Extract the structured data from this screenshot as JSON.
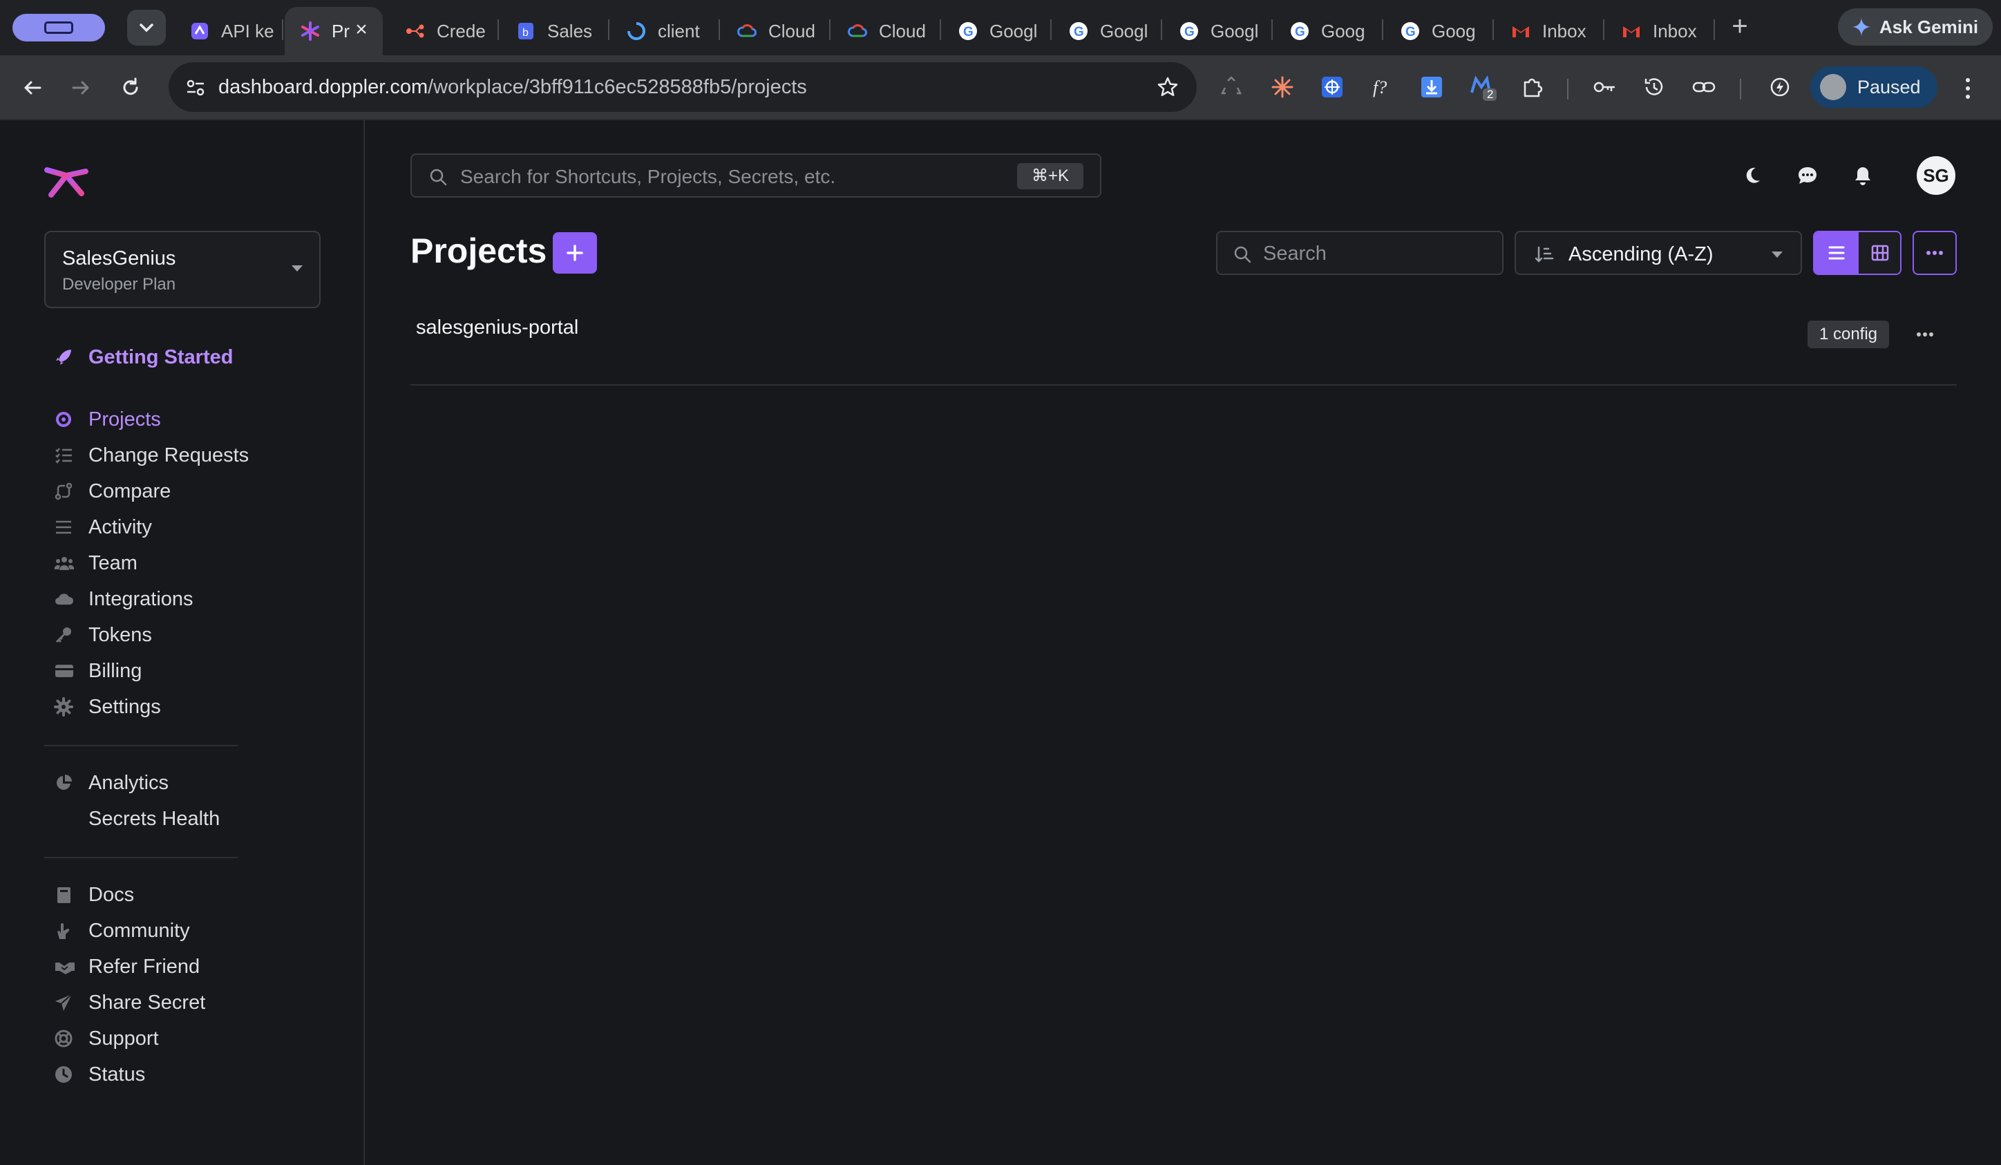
{
  "browser": {
    "tabs": [
      {
        "label": "API ke",
        "favicon": "app-favicon",
        "active": false
      },
      {
        "label": "Pr",
        "favicon": "doppler-favicon",
        "active": true
      },
      {
        "label": "Crede",
        "favicon": "nodes-favicon",
        "active": false
      },
      {
        "label": "Sales",
        "favicon": "salesgenius-favicon",
        "active": false
      },
      {
        "label": "client",
        "favicon": "ring-favicon",
        "active": false
      },
      {
        "label": "Cloud",
        "favicon": "google-cloud-favicon",
        "active": false
      },
      {
        "label": "Cloud",
        "favicon": "google-cloud-favicon",
        "active": false
      },
      {
        "label": "Googl",
        "favicon": "google-favicon",
        "active": false
      },
      {
        "label": "Googl",
        "favicon": "google-favicon",
        "active": false
      },
      {
        "label": "Googl",
        "favicon": "google-favicon",
        "active": false
      },
      {
        "label": "Goog",
        "favicon": "google-favicon",
        "active": false
      },
      {
        "label": "Goog",
        "favicon": "google-favicon",
        "active": false
      },
      {
        "label": "Inbox",
        "favicon": "gmail-favicon",
        "active": false
      },
      {
        "label": "Inbox",
        "favicon": "gmail-favicon",
        "active": false
      }
    ],
    "new_tab": "+",
    "gemini_label": "Ask Gemini",
    "url_host": "dashboard.doppler.com",
    "url_path": "/workplace/3bff911c6ec528588fb5/projects",
    "profile_label": "Paused",
    "extension_badge": "2"
  },
  "sidebar": {
    "workspace_name": "SalesGenius",
    "workspace_plan": "Developer Plan",
    "getting_started": "Getting Started",
    "items": [
      {
        "label": "Projects",
        "icon": "cube-icon"
      },
      {
        "label": "Change Requests",
        "icon": "checklist-icon"
      },
      {
        "label": "Compare",
        "icon": "compare-icon"
      },
      {
        "label": "Activity",
        "icon": "activity-icon"
      },
      {
        "label": "Team",
        "icon": "team-icon"
      },
      {
        "label": "Integrations",
        "icon": "cloud-icon"
      },
      {
        "label": "Tokens",
        "icon": "key-icon"
      },
      {
        "label": "Billing",
        "icon": "credit-card-icon"
      },
      {
        "label": "Settings",
        "icon": "gear-icon"
      }
    ],
    "analytics": [
      {
        "label": "Analytics",
        "icon": "pie-chart-icon"
      },
      {
        "label": "Secrets Health",
        "icon": ""
      }
    ],
    "resources": [
      {
        "label": "Docs",
        "icon": "book-icon"
      },
      {
        "label": "Community",
        "icon": "hand-icon"
      },
      {
        "label": "Refer Friend",
        "icon": "handshake-icon"
      },
      {
        "label": "Share Secret",
        "icon": "paper-plane-icon"
      },
      {
        "label": "Support",
        "icon": "lifebuoy-icon"
      },
      {
        "label": "Status",
        "icon": "clock-icon"
      }
    ]
  },
  "main": {
    "command_search_placeholder": "Search for Shortcuts, Projects, Secrets, etc.",
    "command_shortcut": "⌘+K",
    "user_initials": "SG",
    "title": "Projects",
    "search_placeholder": "Search",
    "sort_value": "Ascending (A-Z)",
    "projects": [
      {
        "name": "salesgenius-portal",
        "badge": "1 config"
      }
    ]
  },
  "colors": {
    "accent": "#8b5cf6",
    "accent_text": "#b98cff",
    "background": "#17181b"
  }
}
